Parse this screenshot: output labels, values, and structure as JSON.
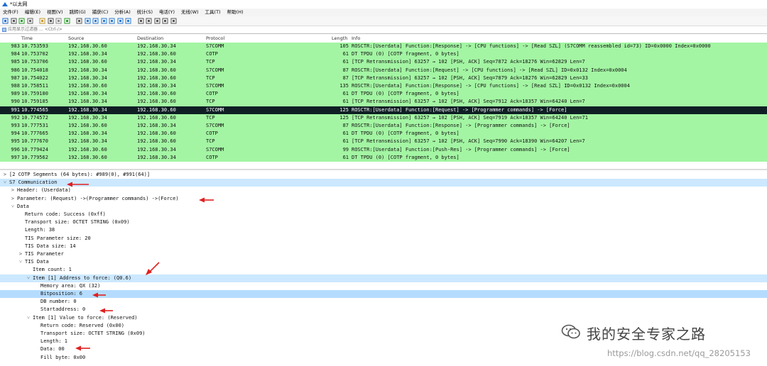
{
  "window": {
    "title": "*以太网"
  },
  "menu": [
    "文件(F)",
    "编辑(E)",
    "视图(V)",
    "跳转(G)",
    "捕获(C)",
    "分析(A)",
    "统计(S)",
    "电话(Y)",
    "无线(W)",
    "工具(T)",
    "帮助(H)"
  ],
  "toolbar_icons": [
    "shark-fin-start-icon",
    "stop-icon",
    "restart-icon",
    "options-gear-icon",
    "open-folder-icon",
    "save-icon",
    "close-file-icon",
    "reload-icon",
    "find-icon",
    "go-back-icon",
    "go-forward-icon",
    "go-to-packet-icon",
    "first-packet-icon",
    "last-packet-icon",
    "autoscroll-icon",
    "colorize-icon",
    "zoom-in-icon",
    "zoom-out-icon",
    "zoom-normal-icon",
    "resize-columns-icon"
  ],
  "filter": {
    "placeholder": "应用显示过滤器 … <Ctrl-/>"
  },
  "columns": {
    "no": "",
    "time": "Time",
    "source": "Source",
    "destination": "Destination",
    "protocol": "Protocol",
    "length": "Length",
    "info": "Info"
  },
  "packets": [
    {
      "no": "983",
      "time": "10.753593",
      "src": "192.168.30.60",
      "dst": "192.168.30.34",
      "proto": "S7COMM",
      "len": "105",
      "info": "ROSCTR:[Userdata] Function:[Response] -> [CPU functions] -> [Read SZL] (S7COMM reassembled id=73) ID=0x0000 Index=0x0000"
    },
    {
      "no": "984",
      "time": "10.753702",
      "src": "192.168.30.34",
      "dst": "192.168.30.60",
      "proto": "COTP",
      "len": "61",
      "info": "DT TPDU (0) [COTP fragment, 0 bytes]"
    },
    {
      "no": "985",
      "time": "10.753706",
      "src": "192.168.30.60",
      "dst": "192.168.30.34",
      "proto": "TCP",
      "len": "61",
      "info": "[TCP Retransmission] 63257 → 102 [PSH, ACK] Seq=7872 Ack=18276 Win=62829 Len=7"
    },
    {
      "no": "986",
      "time": "10.754018",
      "src": "192.168.30.34",
      "dst": "192.168.30.60",
      "proto": "S7COMM",
      "len": "87",
      "info": "ROSCTR:[Userdata] Function:[Request] -> [CPU functions] -> [Read SZL] ID=0x0132 Index=0x0004"
    },
    {
      "no": "987",
      "time": "10.754022",
      "src": "192.168.30.34",
      "dst": "192.168.30.60",
      "proto": "TCP",
      "len": "87",
      "info": "[TCP Retransmission] 63257 → 102 [PSH, ACK] Seq=7879 Ack=18276 Win=62829 Len=33"
    },
    {
      "no": "988",
      "time": "10.758511",
      "src": "192.168.30.60",
      "dst": "192.168.30.34",
      "proto": "S7COMM",
      "len": "135",
      "info": "ROSCTR:[Userdata] Function:[Response] -> [CPU functions] -> [Read SZL] ID=0x0132 Index=0x0004"
    },
    {
      "no": "989",
      "time": "10.759180",
      "src": "192.168.30.34",
      "dst": "192.168.30.60",
      "proto": "COTP",
      "len": "61",
      "info": "DT TPDU (0) [COTP fragment, 0 bytes]"
    },
    {
      "no": "990",
      "time": "10.759185",
      "src": "192.168.30.34",
      "dst": "192.168.30.60",
      "proto": "TCP",
      "len": "61",
      "info": "[TCP Retransmission] 63257 → 102 [PSH, ACK] Seq=7912 Ack=18357 Win=64240 Len=7"
    },
    {
      "no": "991",
      "time": "10.774565",
      "src": "192.168.30.34",
      "dst": "192.168.30.60",
      "proto": "S7COMM",
      "len": "125",
      "info": "ROSCTR:[Userdata] Function:[Request] -> [Programmer commands] -> [Force]"
    },
    {
      "no": "992",
      "time": "10.774572",
      "src": "192.168.30.34",
      "dst": "192.168.30.60",
      "proto": "TCP",
      "len": "125",
      "info": "[TCP Retransmission] 63257 → 102 [PSH, ACK] Seq=7919 Ack=18357 Win=64240 Len=71"
    },
    {
      "no": "993",
      "time": "10.777531",
      "src": "192.168.30.60",
      "dst": "192.168.30.34",
      "proto": "S7COMM",
      "len": "87",
      "info": "ROSCTR:[Userdata] Function:[Response] -> [Programmer commands] -> [Force]"
    },
    {
      "no": "994",
      "time": "10.777665",
      "src": "192.168.30.34",
      "dst": "192.168.30.60",
      "proto": "COTP",
      "len": "61",
      "info": "DT TPDU (0) [COTP fragment, 0 bytes]"
    },
    {
      "no": "995",
      "time": "10.777670",
      "src": "192.168.30.34",
      "dst": "192.168.30.60",
      "proto": "TCP",
      "len": "61",
      "info": "[TCP Retransmission] 63257 → 102 [PSH, ACK] Seq=7990 Ack=18390 Win=64207 Len=7"
    },
    {
      "no": "996",
      "time": "10.779424",
      "src": "192.168.30.60",
      "dst": "192.168.30.34",
      "proto": "S7COMM",
      "len": "99",
      "info": "ROSCTR:[Userdata] Function:[Push-Res] -> [Programmer commands] -> [Force]"
    },
    {
      "no": "997",
      "time": "10.779562",
      "src": "192.168.30.60",
      "dst": "192.168.30.34",
      "proto": "COTP",
      "len": "61",
      "info": "DT TPDU (0) [COTP fragment, 0 bytes]"
    }
  ],
  "details": [
    {
      "text": "[2 COTP Segments (64 bytes): #989(0), #991(64)]",
      "caret": ">"
    },
    {
      "text": "S7 Communication",
      "caret": "v"
    },
    {
      "text": "Header: (Userdata)",
      "caret": ">"
    },
    {
      "text": "Parameter: (Request) ->(Programmer commands) ->(Force)",
      "caret": ">"
    },
    {
      "text": "Data",
      "caret": "v"
    },
    {
      "text": "Return code: Success (0xff)",
      "caret": ""
    },
    {
      "text": "Transport size: OCTET STRING (0x09)",
      "caret": ""
    },
    {
      "text": "Length: 38",
      "caret": ""
    },
    {
      "text": "TIS Parameter size: 20",
      "caret": ""
    },
    {
      "text": "TIS Data size: 14",
      "caret": ""
    },
    {
      "text": "TIS Parameter",
      "caret": ">"
    },
    {
      "text": "TIS Data",
      "caret": "v"
    },
    {
      "text": "Item count: 1",
      "caret": ""
    },
    {
      "text": "Item [1] Address to force: (Q0.6)",
      "caret": "v"
    },
    {
      "text": "Memory area: QX (32)",
      "caret": ""
    },
    {
      "text": "Bitposition: 6",
      "caret": ""
    },
    {
      "text": "DB number: 0",
      "caret": ""
    },
    {
      "text": "Startaddress: 0",
      "caret": ""
    },
    {
      "text": "Item [1] Value to force: (Reserved)",
      "caret": "v"
    },
    {
      "text": "Return code: Reserved (0x00)",
      "caret": ""
    },
    {
      "text": "Transport size: OCTET STRING (0x09)",
      "caret": ""
    },
    {
      "text": "Length: 1",
      "caret": ""
    },
    {
      "text": "Data: 00",
      "caret": ""
    },
    {
      "text": "Fill byte: 0x00",
      "caret": ""
    }
  ],
  "watermark": {
    "text": "我的安全专家之路"
  },
  "blog_url": "https://blog.csdn.net/qq_28205153",
  "colors": {
    "row_green": "#a3f5a3",
    "row_selected": "#0f1f24",
    "highlight": "#cce8ff",
    "annotation_red": "#e02020"
  }
}
